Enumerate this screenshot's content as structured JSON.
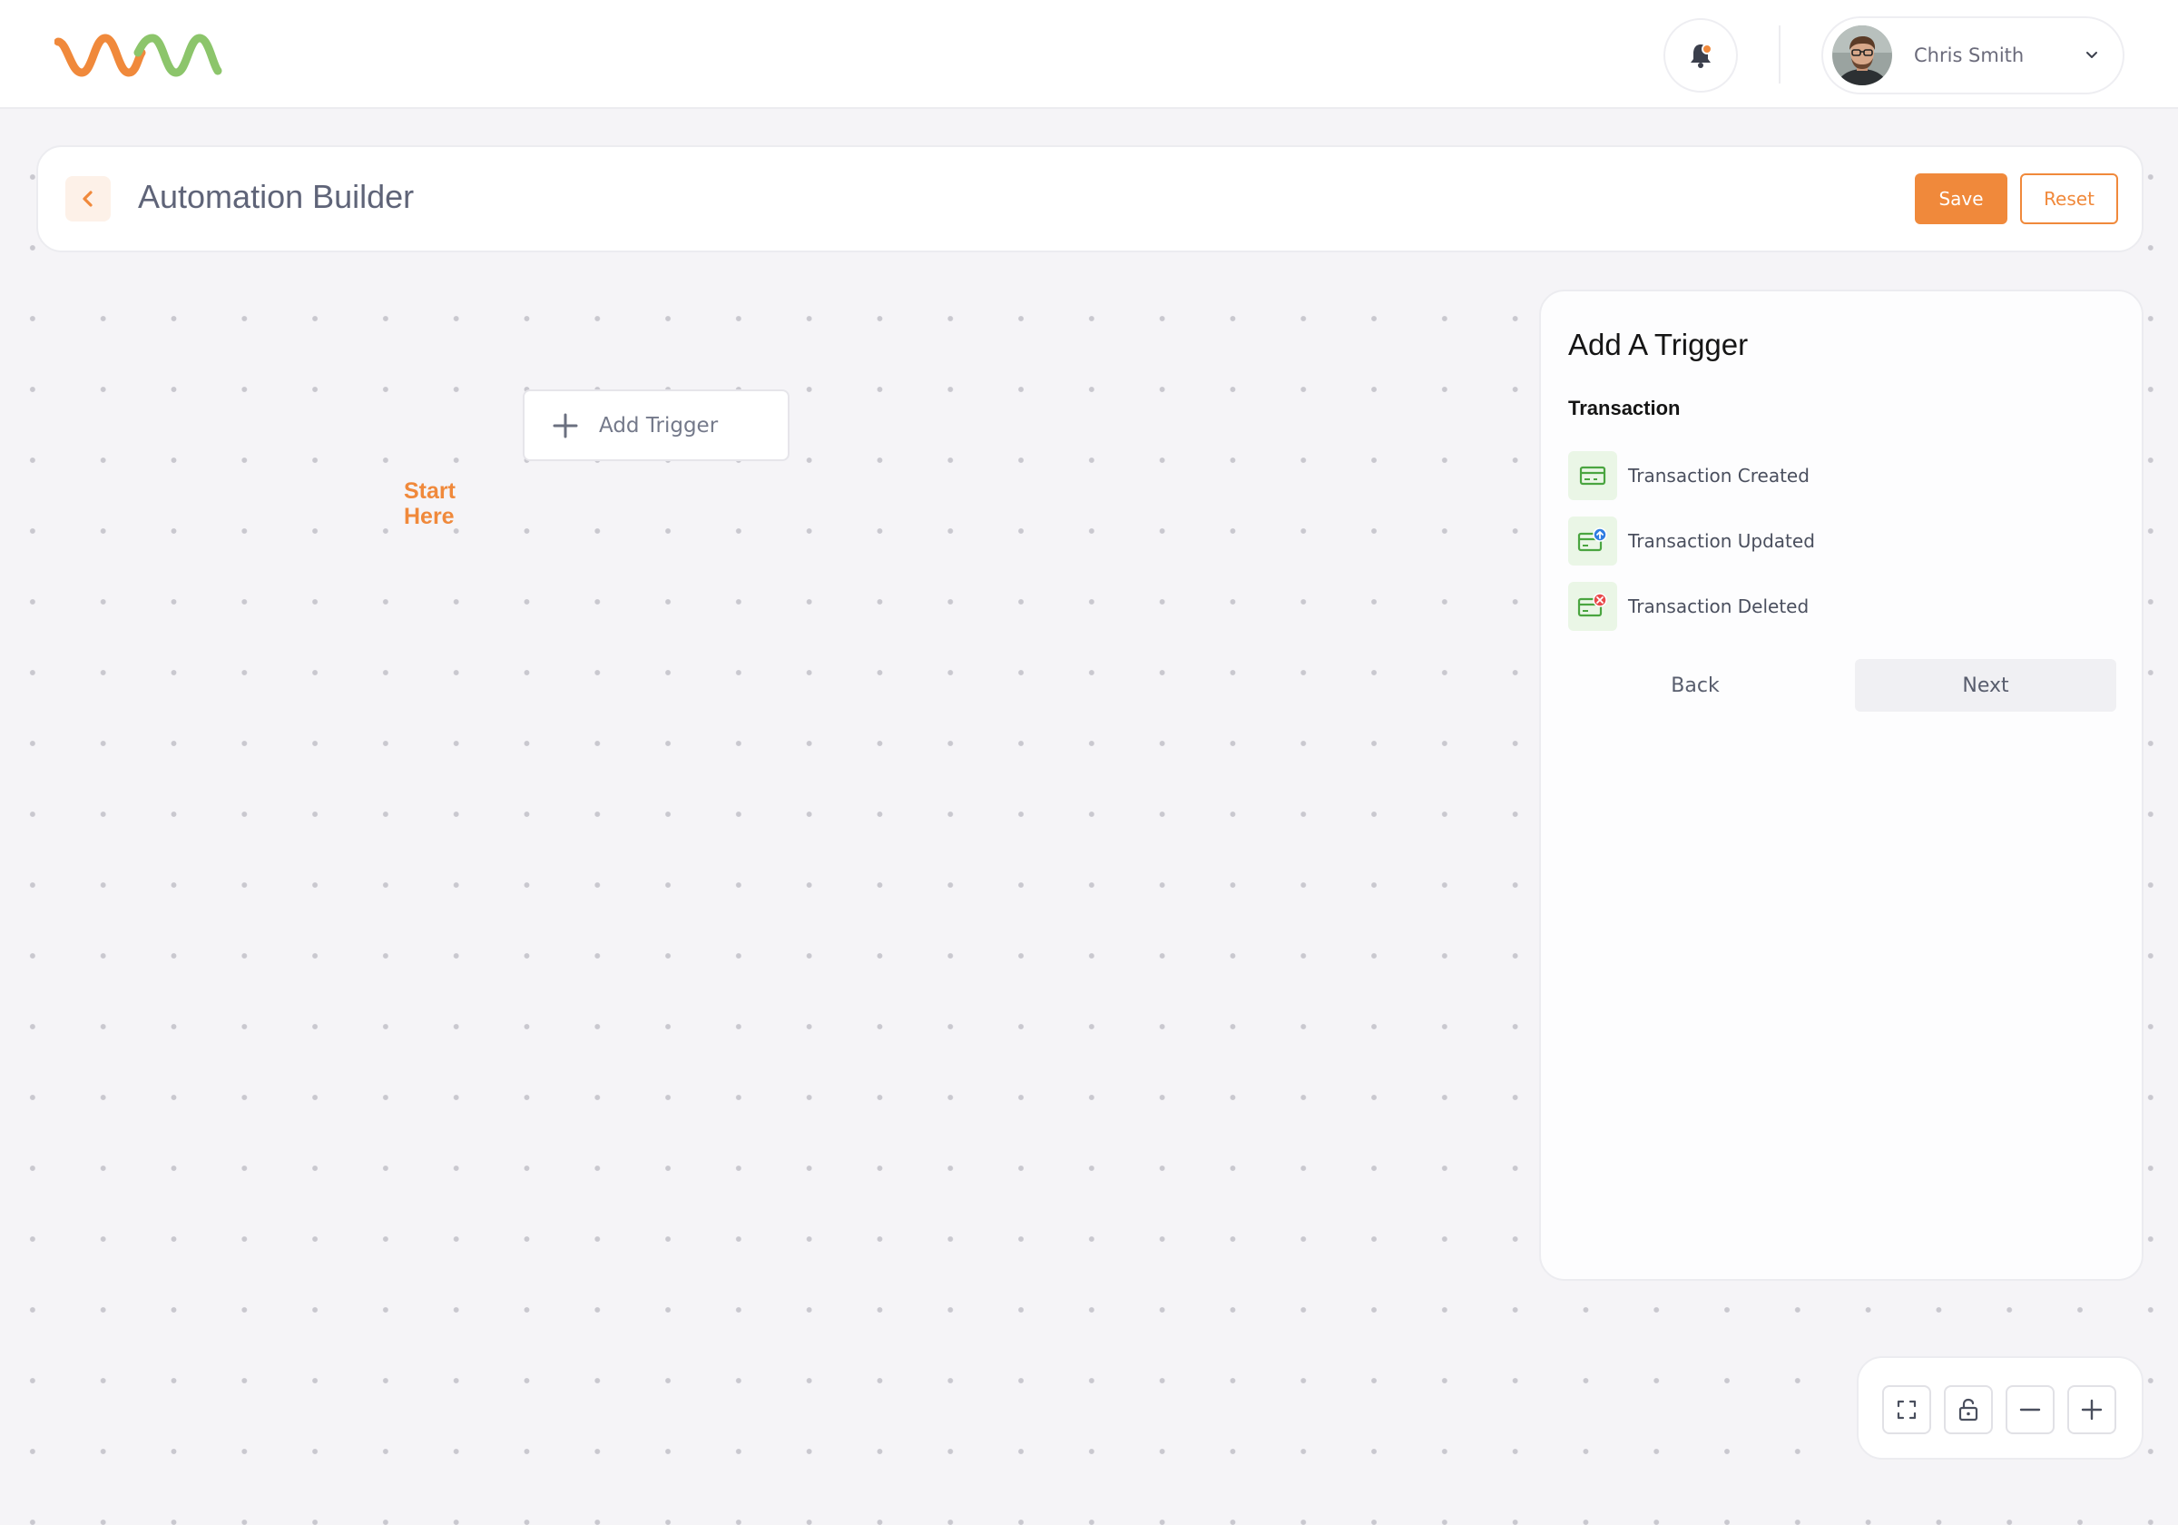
{
  "header": {
    "user_name": "Chris Smith"
  },
  "toolbar": {
    "title": "Automation Builder",
    "save_label": "Save",
    "reset_label": "Reset"
  },
  "canvas": {
    "add_trigger_label": "Add Trigger",
    "start_here_label": "Start Here"
  },
  "panel": {
    "title": "Add A Trigger",
    "section": "Transaction",
    "items": [
      {
        "label": "Transaction Created",
        "icon": "card-icon"
      },
      {
        "label": "Transaction Updated",
        "icon": "card-update-icon"
      },
      {
        "label": "Transaction Deleted",
        "icon": "card-delete-icon"
      }
    ],
    "back_label": "Back",
    "next_label": "Next"
  },
  "colors": {
    "accent": "#f0893b",
    "logo_green": "#8cc56b",
    "icon_green": "#4aa540"
  },
  "controls": {
    "icons": [
      "fullscreen-icon",
      "unlock-icon",
      "zoom-out-icon",
      "zoom-in-icon"
    ]
  }
}
